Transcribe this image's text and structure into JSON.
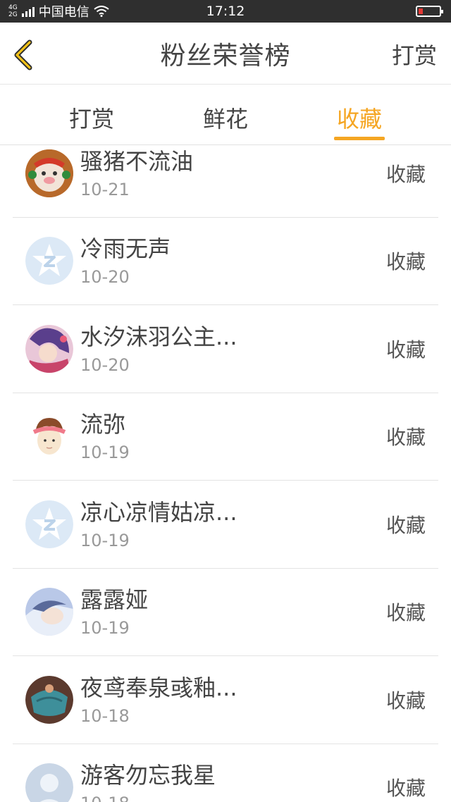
{
  "status": {
    "network_top": "4G",
    "network_bottom": "2G",
    "carrier": "中国电信",
    "time": "17:12"
  },
  "nav": {
    "title": "粉丝荣誉榜",
    "action": "打赏"
  },
  "tabs": [
    {
      "label": "打赏"
    },
    {
      "label": "鲜花"
    },
    {
      "label": "收藏"
    }
  ],
  "list": [
    {
      "name": "骚猪不流油",
      "date": "10-21",
      "action": "收藏"
    },
    {
      "name": "冷雨无声",
      "date": "10-20",
      "action": "收藏"
    },
    {
      "name": "水汐沫羽公主...",
      "date": "10-20",
      "action": "收藏"
    },
    {
      "name": "流弥",
      "date": "10-19",
      "action": "收藏"
    },
    {
      "name": "凉心凉情姑凉...",
      "date": "10-19",
      "action": "收藏"
    },
    {
      "name": "露露娅",
      "date": "10-19",
      "action": "收藏"
    },
    {
      "name": "夜鸢奉泉彧釉...",
      "date": "10-18",
      "action": "收藏"
    },
    {
      "name": "游客勿忘我星",
      "date": "10-18",
      "action": "收藏"
    }
  ],
  "colors": {
    "accent": "#f5a623",
    "back_arrow": "#e6b800"
  }
}
